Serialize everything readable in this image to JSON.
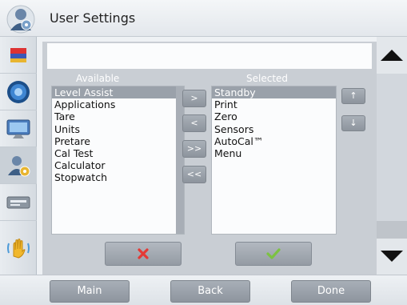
{
  "header": {
    "title": "User Settings",
    "icon": "user-settings-icon"
  },
  "sidebar": {
    "items": [
      {
        "name": "flag-icon"
      },
      {
        "name": "level-bubble-icon"
      },
      {
        "name": "monitor-icon"
      },
      {
        "name": "user-settings-icon",
        "active": true
      },
      {
        "name": "printer-icon"
      },
      {
        "name": "help-hand-icon"
      }
    ]
  },
  "lists": {
    "available_label": "Available",
    "selected_label": "Selected",
    "available": [
      "Level Assist",
      "Applications",
      "Tare",
      "Units",
      "Pretare",
      "Cal Test",
      "Calculator",
      "Stopwatch"
    ],
    "selected": [
      "Standby",
      "Print",
      "Zero",
      "Sensors",
      "AutoCal™",
      "Menu"
    ],
    "available_highlight": "Level Assist",
    "selected_highlight": "Standby"
  },
  "transfer": {
    "add_label": ">",
    "remove_label": "<",
    "add_all_label": ">>",
    "remove_all_label": "<<",
    "move_up_label": "↑",
    "move_down_label": "↓"
  },
  "actions": {
    "cancel_icon": "red-x-icon",
    "accept_icon": "green-check-icon"
  },
  "footer": {
    "main_label": "Main",
    "back_label": "Back",
    "done_label": "Done"
  },
  "colors": {
    "cancel": "#e53935",
    "accept": "#7cc242",
    "highlight": "#9aa1aa"
  }
}
